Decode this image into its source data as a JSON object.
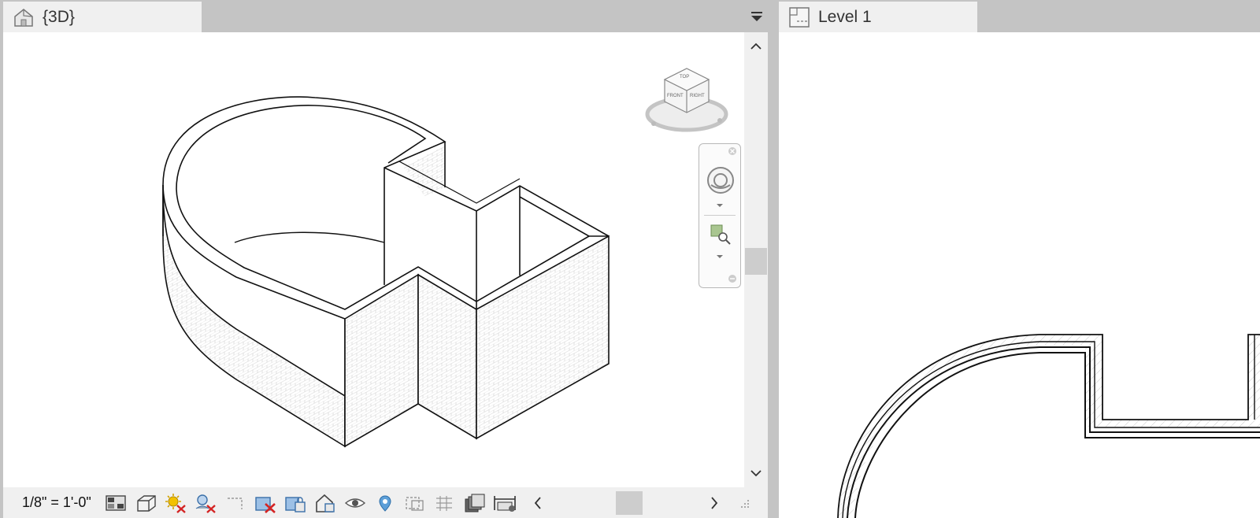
{
  "left_view": {
    "tab_title": "{3D}",
    "tab_icon": "house-3d-icon",
    "viewcube_faces": [
      "FRONT",
      "RIGHT",
      "TOP"
    ],
    "scale_label": "1/8\" = 1'-0\"",
    "view_control_icons": [
      "visual-style-icon",
      "view-cube-toggle-icon",
      "sun-path-off-icon",
      "shadows-off-icon",
      "crop-view-icon",
      "show-crop-region-icon",
      "unlock-3d-view-icon",
      "temporary-hide-isolate-icon",
      "reveal-hidden-elements-icon",
      "analytical-model-icon",
      "highlight-displacement-icon",
      "worksharing-display-icon",
      "temporary-view-properties-icon",
      "show-constraints-icon"
    ]
  },
  "right_view": {
    "tab_title": "Level 1",
    "tab_icon": "floor-plan-icon"
  },
  "colors": {
    "tab_bg": "#f0f0f0",
    "chrome_bg": "#c4c4c4",
    "canvas_bg": "#ffffff",
    "wall_line": "#111111",
    "wall_hatch": "#c8c8c8"
  }
}
